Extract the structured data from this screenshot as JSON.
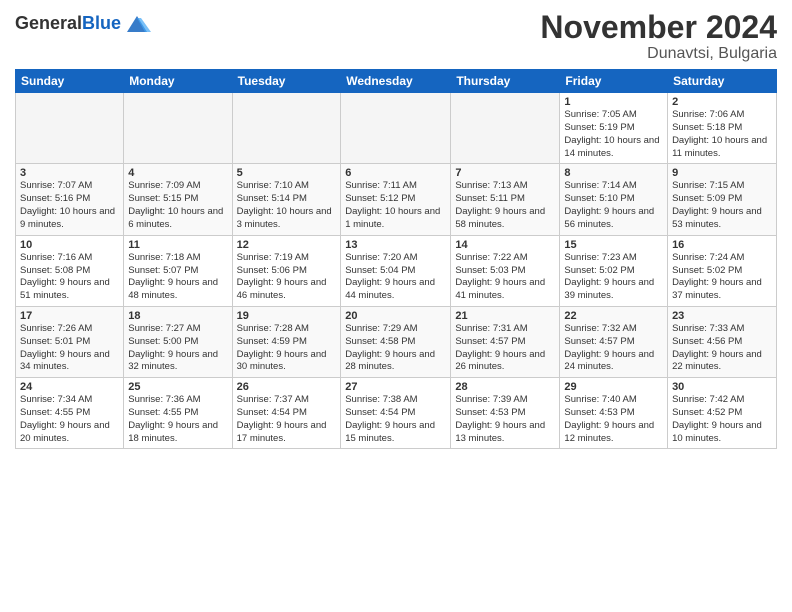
{
  "header": {
    "logo_general": "General",
    "logo_blue": "Blue",
    "month_title": "November 2024",
    "location": "Dunavtsi, Bulgaria"
  },
  "days_of_week": [
    "Sunday",
    "Monday",
    "Tuesday",
    "Wednesday",
    "Thursday",
    "Friday",
    "Saturday"
  ],
  "weeks": [
    [
      {
        "day": "",
        "empty": true
      },
      {
        "day": "",
        "empty": true
      },
      {
        "day": "",
        "empty": true
      },
      {
        "day": "",
        "empty": true
      },
      {
        "day": "",
        "empty": true
      },
      {
        "day": "1",
        "sunrise": "7:05 AM",
        "sunset": "5:19 PM",
        "daylight": "10 hours and 14 minutes."
      },
      {
        "day": "2",
        "sunrise": "7:06 AM",
        "sunset": "5:18 PM",
        "daylight": "10 hours and 11 minutes."
      }
    ],
    [
      {
        "day": "3",
        "sunrise": "7:07 AM",
        "sunset": "5:16 PM",
        "daylight": "10 hours and 9 minutes."
      },
      {
        "day": "4",
        "sunrise": "7:09 AM",
        "sunset": "5:15 PM",
        "daylight": "10 hours and 6 minutes."
      },
      {
        "day": "5",
        "sunrise": "7:10 AM",
        "sunset": "5:14 PM",
        "daylight": "10 hours and 3 minutes."
      },
      {
        "day": "6",
        "sunrise": "7:11 AM",
        "sunset": "5:12 PM",
        "daylight": "10 hours and 1 minute."
      },
      {
        "day": "7",
        "sunrise": "7:13 AM",
        "sunset": "5:11 PM",
        "daylight": "9 hours and 58 minutes."
      },
      {
        "day": "8",
        "sunrise": "7:14 AM",
        "sunset": "5:10 PM",
        "daylight": "9 hours and 56 minutes."
      },
      {
        "day": "9",
        "sunrise": "7:15 AM",
        "sunset": "5:09 PM",
        "daylight": "9 hours and 53 minutes."
      }
    ],
    [
      {
        "day": "10",
        "sunrise": "7:16 AM",
        "sunset": "5:08 PM",
        "daylight": "9 hours and 51 minutes."
      },
      {
        "day": "11",
        "sunrise": "7:18 AM",
        "sunset": "5:07 PM",
        "daylight": "9 hours and 48 minutes."
      },
      {
        "day": "12",
        "sunrise": "7:19 AM",
        "sunset": "5:06 PM",
        "daylight": "9 hours and 46 minutes."
      },
      {
        "day": "13",
        "sunrise": "7:20 AM",
        "sunset": "5:04 PM",
        "daylight": "9 hours and 44 minutes."
      },
      {
        "day": "14",
        "sunrise": "7:22 AM",
        "sunset": "5:03 PM",
        "daylight": "9 hours and 41 minutes."
      },
      {
        "day": "15",
        "sunrise": "7:23 AM",
        "sunset": "5:02 PM",
        "daylight": "9 hours and 39 minutes."
      },
      {
        "day": "16",
        "sunrise": "7:24 AM",
        "sunset": "5:02 PM",
        "daylight": "9 hours and 37 minutes."
      }
    ],
    [
      {
        "day": "17",
        "sunrise": "7:26 AM",
        "sunset": "5:01 PM",
        "daylight": "9 hours and 34 minutes."
      },
      {
        "day": "18",
        "sunrise": "7:27 AM",
        "sunset": "5:00 PM",
        "daylight": "9 hours and 32 minutes."
      },
      {
        "day": "19",
        "sunrise": "7:28 AM",
        "sunset": "4:59 PM",
        "daylight": "9 hours and 30 minutes."
      },
      {
        "day": "20",
        "sunrise": "7:29 AM",
        "sunset": "4:58 PM",
        "daylight": "9 hours and 28 minutes."
      },
      {
        "day": "21",
        "sunrise": "7:31 AM",
        "sunset": "4:57 PM",
        "daylight": "9 hours and 26 minutes."
      },
      {
        "day": "22",
        "sunrise": "7:32 AM",
        "sunset": "4:57 PM",
        "daylight": "9 hours and 24 minutes."
      },
      {
        "day": "23",
        "sunrise": "7:33 AM",
        "sunset": "4:56 PM",
        "daylight": "9 hours and 22 minutes."
      }
    ],
    [
      {
        "day": "24",
        "sunrise": "7:34 AM",
        "sunset": "4:55 PM",
        "daylight": "9 hours and 20 minutes."
      },
      {
        "day": "25",
        "sunrise": "7:36 AM",
        "sunset": "4:55 PM",
        "daylight": "9 hours and 18 minutes."
      },
      {
        "day": "26",
        "sunrise": "7:37 AM",
        "sunset": "4:54 PM",
        "daylight": "9 hours and 17 minutes."
      },
      {
        "day": "27",
        "sunrise": "7:38 AM",
        "sunset": "4:54 PM",
        "daylight": "9 hours and 15 minutes."
      },
      {
        "day": "28",
        "sunrise": "7:39 AM",
        "sunset": "4:53 PM",
        "daylight": "9 hours and 13 minutes."
      },
      {
        "day": "29",
        "sunrise": "7:40 AM",
        "sunset": "4:53 PM",
        "daylight": "9 hours and 12 minutes."
      },
      {
        "day": "30",
        "sunrise": "7:42 AM",
        "sunset": "4:52 PM",
        "daylight": "9 hours and 10 minutes."
      }
    ]
  ]
}
